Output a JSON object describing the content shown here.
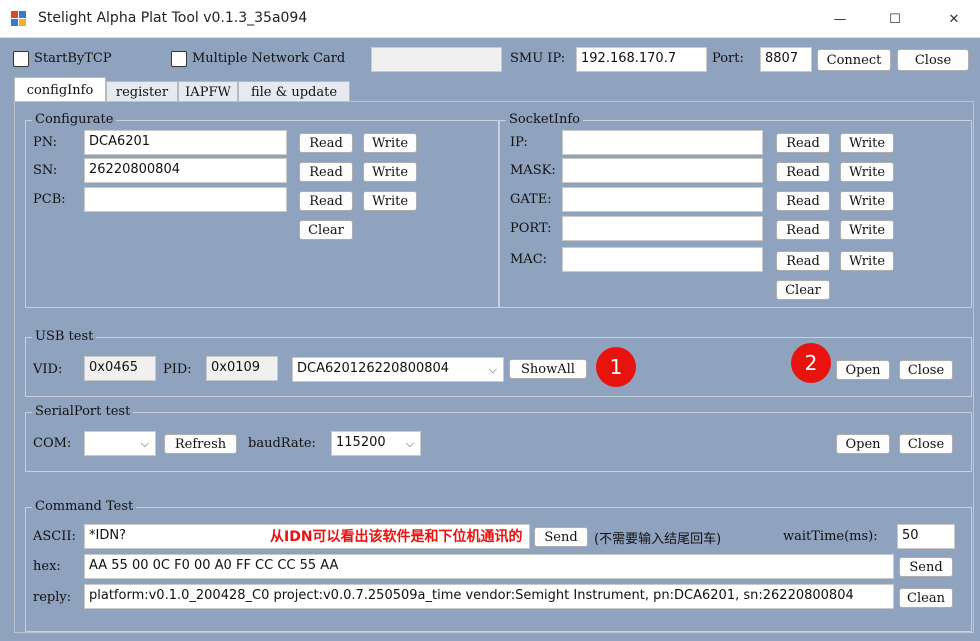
{
  "window": {
    "title": "Stelight Alpha Plat Tool v0.1.3_35a094",
    "minimize_glyph": "—",
    "maximize_glyph": "☐",
    "close_glyph": "✕"
  },
  "topbar": {
    "start_by_tcp_label": "StartByTCP",
    "start_by_tcp_checked": false,
    "multiple_network_card_label": "Multiple Network Card",
    "multiple_network_card_checked": false,
    "network_card_value": "",
    "smu_ip_label": "SMU IP:",
    "smu_ip_value": "192.168.170.7",
    "port_label": "Port:",
    "port_value": "8807",
    "connect_label": "Connect",
    "close_label": "Close"
  },
  "tabs": [
    {
      "label": "configInfo",
      "active": true
    },
    {
      "label": "register",
      "active": false
    },
    {
      "label": "IAPFW",
      "active": false
    },
    {
      "label": "file & update",
      "active": false
    }
  ],
  "configurate": {
    "title": "Configurate",
    "rows": [
      {
        "label": "PN:",
        "value": "DCA6201",
        "read": "Read",
        "write": "Write"
      },
      {
        "label": "SN:",
        "value": "26220800804",
        "read": "Read",
        "write": "Write"
      },
      {
        "label": "PCB:",
        "value": "",
        "read": "Read",
        "write": "Write"
      }
    ],
    "clear_label": "Clear"
  },
  "socketinfo": {
    "title": "SocketInfo",
    "rows": [
      {
        "label": "IP:",
        "value": "",
        "read": "Read",
        "write": "Write"
      },
      {
        "label": "MASK:",
        "value": "",
        "read": "Read",
        "write": "Write"
      },
      {
        "label": "GATE:",
        "value": "",
        "read": "Read",
        "write": "Write"
      },
      {
        "label": "PORT:",
        "value": "",
        "read": "Read",
        "write": "Write"
      },
      {
        "label": "MAC:",
        "value": "",
        "read": "Read",
        "write": "Write"
      }
    ],
    "clear_label": "Clear"
  },
  "usb": {
    "title": "USB test",
    "vid_label": "VID:",
    "vid_value": "0x0465",
    "pid_label": "PID:",
    "pid_value": "0x0109",
    "device_value": "DCA620126220800804",
    "showall_label": "ShowAll",
    "open_label": "Open",
    "close_label": "Close"
  },
  "serial": {
    "title": "SerialPort test",
    "com_label": "COM:",
    "com_value": "",
    "refresh_label": "Refresh",
    "baud_label": "baudRate:",
    "baud_value": "115200",
    "open_label": "Open",
    "close_label": "Close"
  },
  "command": {
    "title": "Command Test",
    "ascii_label": "ASCII:",
    "ascii_value": "*IDN?",
    "ascii_send_label": "Send",
    "no_newline_note": "(不需要输入结尾回车)",
    "wait_label": "waitTime(ms):",
    "wait_value": "50",
    "hex_label": "hex:",
    "hex_value": "AA 55 00 0C F0 00 A0 FF CC CC 55 AA",
    "hex_send_label": "Send",
    "reply_label": "reply:",
    "reply_value": "platform:v0.1.0_200428_C0 project:v0.0.7.250509a_time vendor:Semight Instrument, pn:DCA6201, sn:26220800804",
    "clean_label": "Clean"
  },
  "annotations": {
    "badge1": "1",
    "badge2": "2",
    "note": "从IDN可以看出该软件是和下位机通讯的",
    "color": "#e8120f"
  }
}
